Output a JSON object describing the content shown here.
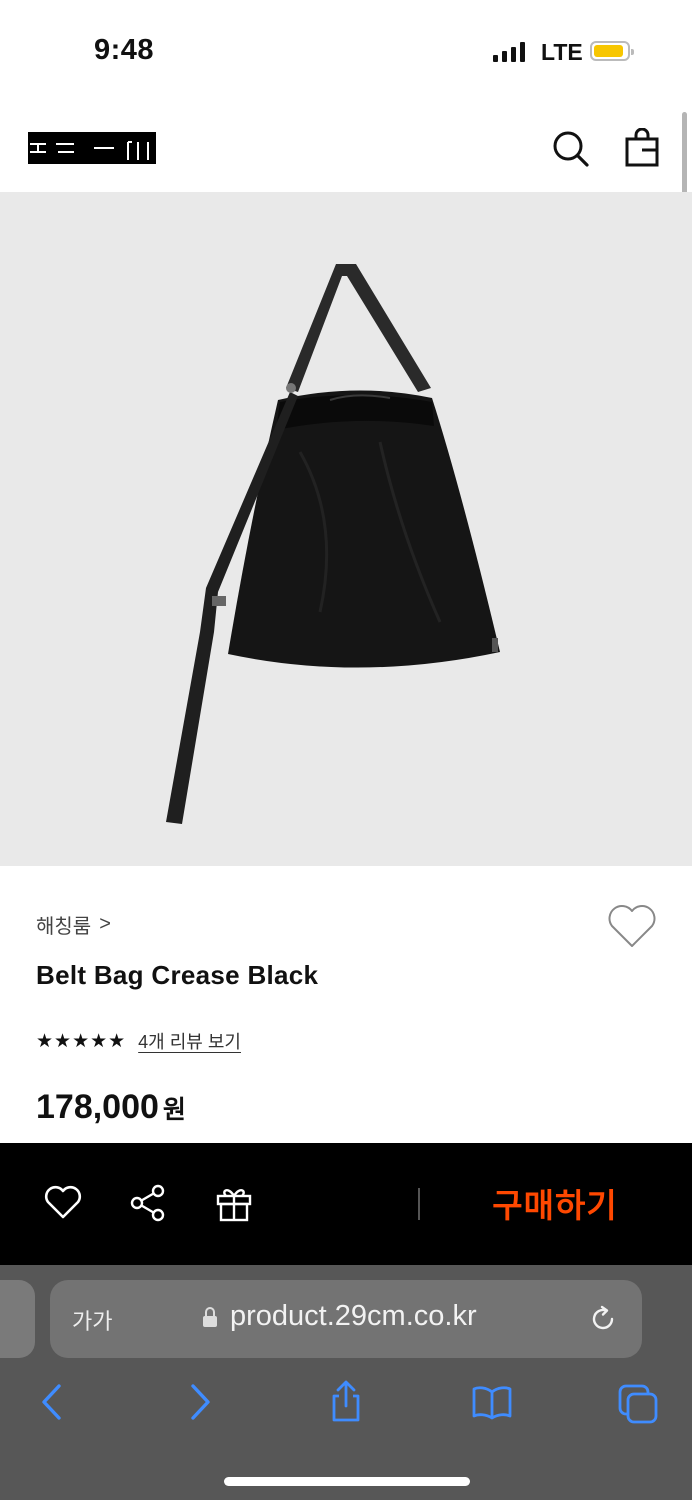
{
  "status_bar": {
    "time": "9:48",
    "network": "LTE",
    "battery_color": "#f7c600"
  },
  "header": {
    "logo_icon": "29cm-logo-icon",
    "search_icon": "search-icon",
    "cart_icon": "shopping-bag-icon"
  },
  "product": {
    "image_icon": "black-drawstring-belt-bag",
    "brand": "해칭룸",
    "brand_chevron": ">",
    "title": "Belt Bag Crease Black",
    "stars": "★★★★★",
    "rating": 5,
    "review_link": "4개 리뷰 보기",
    "price": "178,000",
    "currency": "원"
  },
  "action_bar": {
    "buy_label": "구매하기",
    "buy_color": "#ff4800"
  },
  "browser": {
    "text_size_label": "가가",
    "url": "product.29cm.co.kr"
  }
}
